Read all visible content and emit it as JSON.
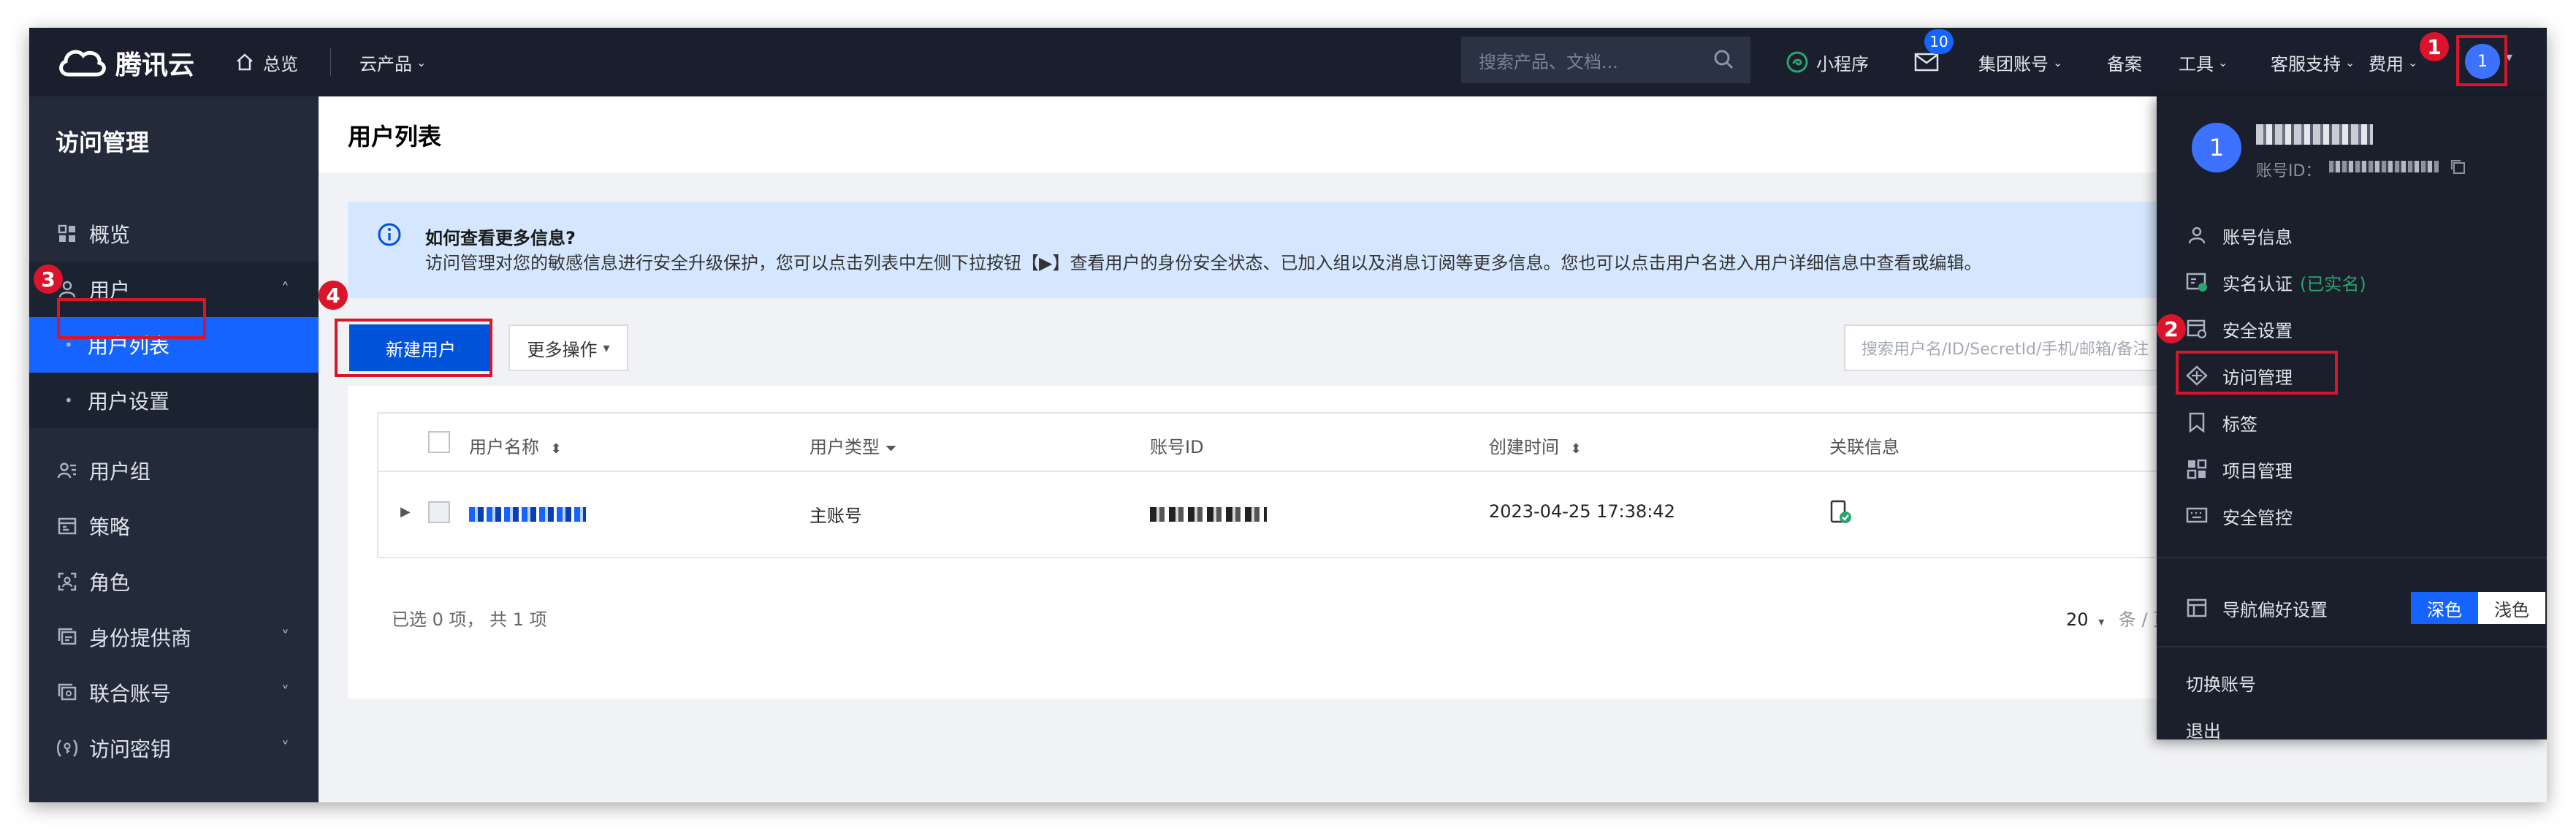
{
  "topbar": {
    "brand": "腾讯云",
    "overview": "总览",
    "products": "云产品",
    "search_placeholder": "搜索产品、文档...",
    "miniapp": "小程序",
    "mail_badge": "10",
    "group_account": "集团账号",
    "filing": "备案",
    "tools": "工具",
    "support": "客服支持",
    "billing": "费用",
    "avatar_initial": "1"
  },
  "markers": [
    "1",
    "2",
    "3",
    "4"
  ],
  "sidebar": {
    "title": "访问管理",
    "items": [
      {
        "label": "概览"
      },
      {
        "label": "用户"
      },
      {
        "label": "用户列表"
      },
      {
        "label": "用户设置"
      },
      {
        "label": "用户组"
      },
      {
        "label": "策略"
      },
      {
        "label": "角色"
      },
      {
        "label": "身份提供商"
      },
      {
        "label": "联合账号"
      },
      {
        "label": "访问密钥"
      }
    ]
  },
  "main": {
    "title": "用户列表",
    "info_title": "如何查看更多信息?",
    "info_text": "访问管理对您的敏感信息进行安全升级保护，您可以点击列表中左侧下拉按钮【▶】查看用户的身份安全状态、已加入组以及消息订阅等更多信息。您也可以点击用户名进入用户详细信息中查看或编辑。",
    "new_user": "新建用户",
    "more_actions": "更多操作",
    "search_placeholder": "搜索用户名/ID/SecretId/手机/邮箱/备注",
    "columns": [
      "用户名称",
      "用户类型",
      "账号ID",
      "创建时间",
      "关联信息"
    ],
    "row": {
      "type": "主账号",
      "created": "2023-04-25 17:38:42"
    },
    "footer": "已选 0 项， 共 1 项",
    "page_size": "20",
    "page_unit": "条 / 页"
  },
  "dropdown": {
    "avatar_initial": "1",
    "id_label": "账号ID：",
    "items": [
      "账号信息",
      "实名认证",
      "安全设置",
      "访问管理",
      "标签",
      "项目管理",
      "安全管控",
      "导航偏好设置",
      "切换账号",
      "退出"
    ],
    "verified": "(已实名)",
    "theme_dark": "深色",
    "theme_light": "浅色"
  },
  "colors": {
    "primary": "#1664ff",
    "annotation": "#d9142b",
    "verified": "#2ba471"
  }
}
